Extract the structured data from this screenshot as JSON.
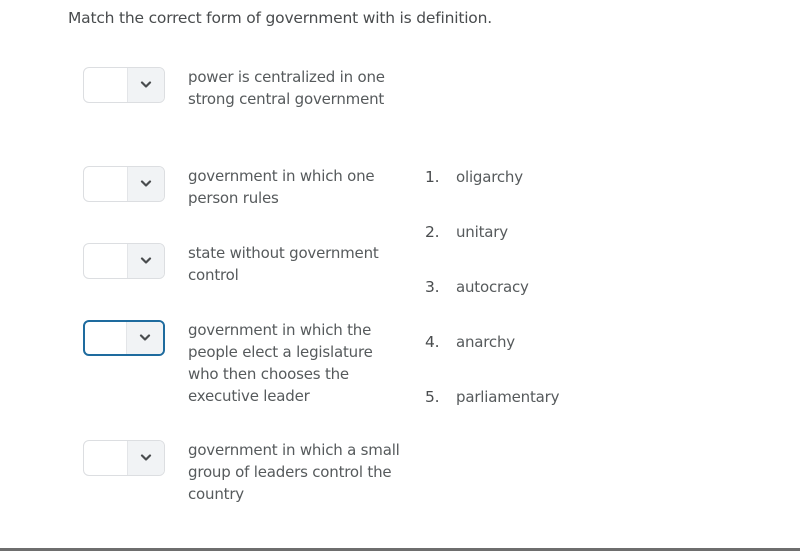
{
  "question": "Match the correct form of government with is definition.",
  "definitions": [
    {
      "text": "power is centralized in one strong central government",
      "selected": "",
      "focused": false
    },
    {
      "text": "government in which one person rules",
      "selected": "",
      "focused": false
    },
    {
      "text": "state without government control",
      "selected": "",
      "focused": false
    },
    {
      "text": "government in which the people elect a legislature who then chooses the executive leader",
      "selected": "",
      "focused": true
    },
    {
      "text": "government in which a small group of leaders control the country",
      "selected": "",
      "focused": false
    }
  ],
  "options": [
    {
      "number": "1.",
      "label": "oligarchy"
    },
    {
      "number": "2.",
      "label": "unitary"
    },
    {
      "number": "3.",
      "label": "autocracy"
    },
    {
      "number": "4.",
      "label": "anarchy"
    },
    {
      "number": "5.",
      "label": "parliamentary"
    }
  ],
  "icons": {
    "dropdown": "chevron-down-icon"
  },
  "colors": {
    "focus_border": "#1e6b9e",
    "text": "#494c4e"
  }
}
